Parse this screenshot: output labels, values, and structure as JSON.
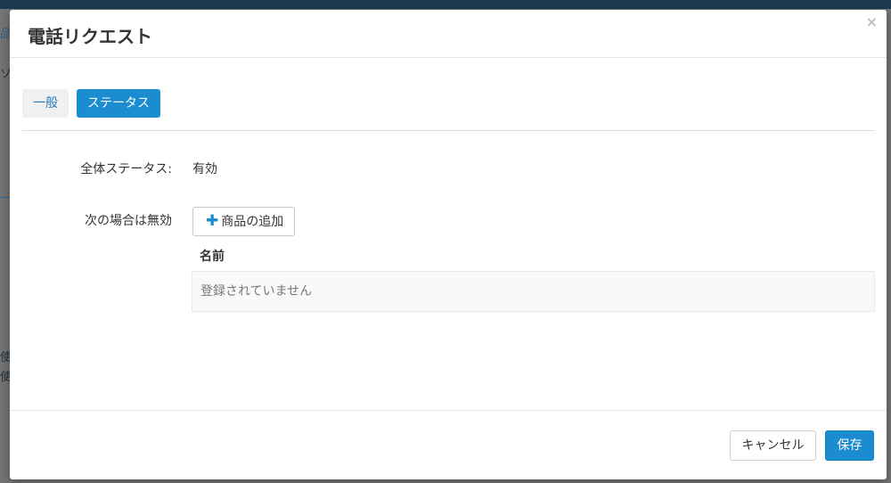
{
  "background": {
    "fragments": [
      "品",
      "ソ",
      "使",
      "使"
    ]
  },
  "modal": {
    "title": "電話リクエスト",
    "close_symbol": "×"
  },
  "tabs": [
    {
      "label": "一般",
      "active": false
    },
    {
      "label": "ステータス",
      "active": true
    }
  ],
  "form": {
    "overall_status_label": "全体ステータス:",
    "overall_status_value": "有効",
    "disabled_when_label": "次の場合は無効",
    "add_product_label": "商品の追加",
    "table": {
      "columns": [
        "名前"
      ],
      "empty_text": "登録されていません"
    }
  },
  "footer": {
    "cancel_label": "キャンセル",
    "save_label": "保存"
  },
  "colors": {
    "accent": "#1b8ccf",
    "overlay": "#6f6f6f"
  }
}
